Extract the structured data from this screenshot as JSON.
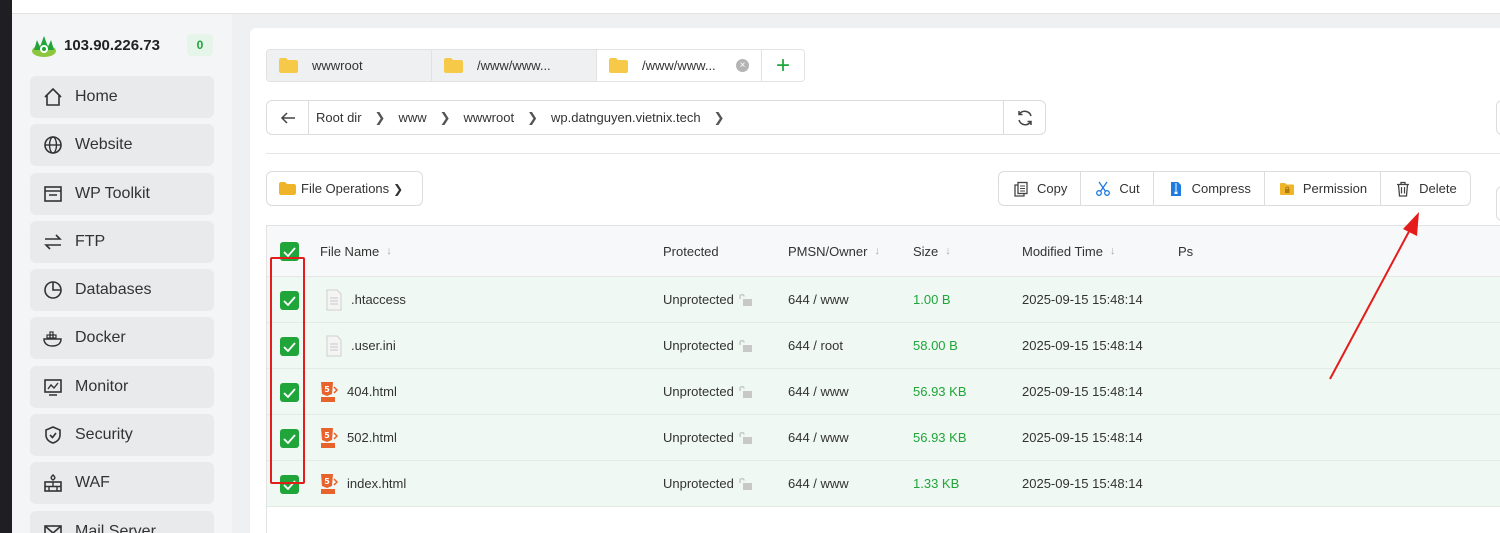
{
  "server": {
    "ip": "103.90.226.73",
    "badge": "0"
  },
  "sidebar": {
    "items": [
      {
        "label": "Home",
        "icon": "home-icon"
      },
      {
        "label": "Website",
        "icon": "globe-icon"
      },
      {
        "label": "WP Toolkit",
        "icon": "wp-toolkit-icon"
      },
      {
        "label": "FTP",
        "icon": "transfer-icon"
      },
      {
        "label": "Databases",
        "icon": "database-icon"
      },
      {
        "label": "Docker",
        "icon": "docker-icon"
      },
      {
        "label": "Monitor",
        "icon": "monitor-icon"
      },
      {
        "label": "Security",
        "icon": "shield-icon"
      },
      {
        "label": "WAF",
        "icon": "firewall-icon"
      },
      {
        "label": "Mail Server",
        "icon": "mail-icon"
      }
    ]
  },
  "tabs": [
    {
      "label": "wwwroot"
    },
    {
      "label": "/www/www..."
    },
    {
      "label": "/www/www..."
    }
  ],
  "breadcrumb": {
    "items": [
      "Root dir",
      "www",
      "wwwroot",
      "wp.datnguyen.vietnix.tech"
    ]
  },
  "toolbar": {
    "file_operations": "File Operations",
    "actions": [
      "Copy",
      "Cut",
      "Compress",
      "Permission",
      "Delete"
    ]
  },
  "table": {
    "columns": [
      "File Name",
      "Protected",
      "PMSN/Owner",
      "Size",
      "Modified Time",
      "Ps"
    ],
    "rows": [
      {
        "name": ".htaccess",
        "type": "text",
        "protected": "Unprotected",
        "owner": "644 / www",
        "size": "1.00 B",
        "modified": "2025-09-15 15:48:14"
      },
      {
        "name": ".user.ini",
        "type": "text",
        "protected": "Unprotected",
        "owner": "644 / root",
        "size": "58.00 B",
        "modified": "2025-09-15 15:48:14"
      },
      {
        "name": "404.html",
        "type": "html",
        "protected": "Unprotected",
        "owner": "644 / www",
        "size": "56.93 KB",
        "modified": "2025-09-15 15:48:14"
      },
      {
        "name": "502.html",
        "type": "html",
        "protected": "Unprotected",
        "owner": "644 / www",
        "size": "56.93 KB",
        "modified": "2025-09-15 15:48:14"
      },
      {
        "name": "index.html",
        "type": "html",
        "protected": "Unprotected",
        "owner": "644 / www",
        "size": "1.33 KB",
        "modified": "2025-09-15 15:48:14"
      }
    ]
  },
  "colors": {
    "accent": "#20a53a",
    "annotation": "#e51c1c"
  }
}
